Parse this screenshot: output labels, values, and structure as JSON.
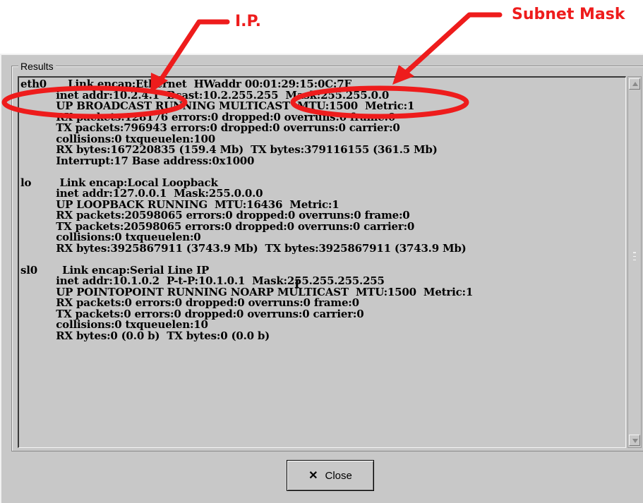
{
  "annotations": {
    "ip_label": "I.P.",
    "subnet_label": "Subnet Mask",
    "color": "#ee1c1c"
  },
  "dialog": {
    "group_title": "Results",
    "output_lines": [
      "eth0      Link encap:Ethernet  HWaddr 00:01:29:15:0C:7F",
      "          inet addr:10.2.4.1  Bcast:10.2.255.255  Mask:255.255.0.0",
      "          UP BROADCAST RUNNING MULTICAST  MTU:1500  Metric:1",
      "          RX packets:128176 errors:0 dropped:0 overruns:0 frame:0",
      "          TX packets:796943 errors:0 dropped:0 overruns:0 carrier:0",
      "          collisions:0 txqueuelen:100",
      "          RX bytes:167220835 (159.4 Mb)  TX bytes:379116155 (361.5 Mb)",
      "          Interrupt:17 Base address:0x1000",
      "",
      "lo        Link encap:Local Loopback",
      "          inet addr:127.0.0.1  Mask:255.0.0.0",
      "          UP LOOPBACK RUNNING  MTU:16436  Metric:1",
      "          RX packets:20598065 errors:0 dropped:0 overruns:0 frame:0",
      "          TX packets:20598065 errors:0 dropped:0 overruns:0 carrier:0",
      "          collisions:0 txqueuelen:0",
      "          RX bytes:3925867911 (3743.9 Mb)  TX bytes:3925867911 (3743.9 Mb)",
      "",
      "sl0       Link encap:Serial Line IP",
      "          inet addr:10.1.0.2  P-t-P:10.1.0.1  Mask:255.255.255.255",
      "          UP POINTOPOINT RUNNING NOARP MULTICAST  MTU:1500  Metric:1",
      "          RX packets:0 errors:0 dropped:0 overruns:0 frame:0",
      "          TX packets:0 errors:0 dropped:0 overruns:0 carrier:0",
      "          collisions:0 txqueuelen:10",
      "          RX bytes:0 (0.0 b)  TX bytes:0 (0.0 b)"
    ],
    "close_label": "Close",
    "close_icon": "x-icon"
  }
}
